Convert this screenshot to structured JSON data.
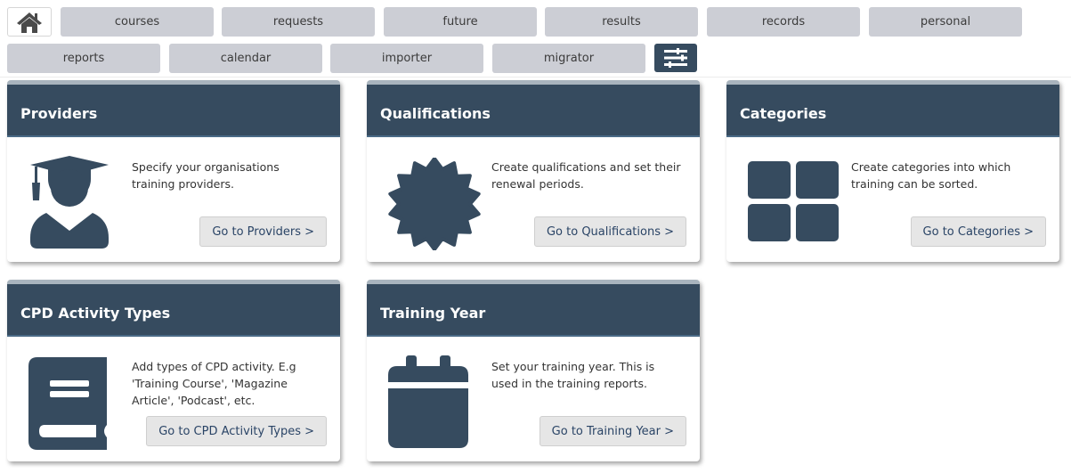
{
  "nav": {
    "home_icon": "home-icon",
    "settings_icon": "sliders-icon",
    "row1": [
      "courses",
      "requests",
      "future",
      "results",
      "records",
      "personal"
    ],
    "row2": [
      "reports",
      "calendar",
      "importer",
      "migrator"
    ]
  },
  "colors": {
    "header": "#364b5f",
    "nav_button": "#ccced5",
    "link": "#2a4466"
  },
  "cards": [
    {
      "title": "Providers",
      "icon": "graduate-icon",
      "description": "Specify your organisations training providers.",
      "button": "Go to Providers >"
    },
    {
      "title": "Qualifications",
      "icon": "certificate-badge-icon",
      "description": "Create qualifications and set their renewal periods.",
      "button": "Go to Qualifications >"
    },
    {
      "title": "Categories",
      "icon": "grid-icon",
      "description": "Create categories into which training can be sorted.",
      "button": "Go to Categories >"
    },
    {
      "title": "CPD Activity Types",
      "icon": "book-icon",
      "description": "Add types of CPD activity. E.g 'Training Course', 'Magazine Article', 'Podcast', etc.",
      "button": "Go to CPD Activity Types >"
    },
    {
      "title": "Training Year",
      "icon": "calendar-icon",
      "description": "Set your training year. This is used in the training reports.",
      "button": "Go to Training Year >"
    }
  ]
}
